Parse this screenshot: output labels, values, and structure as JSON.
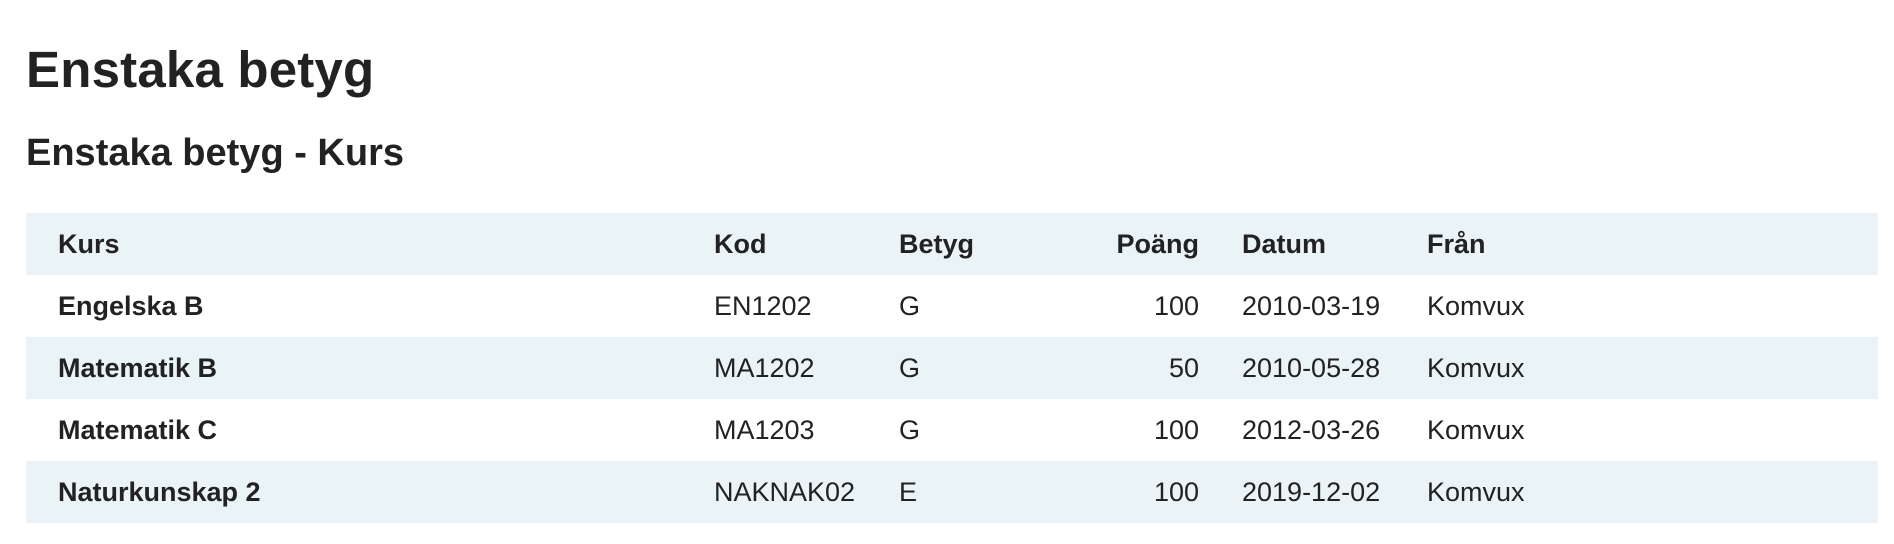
{
  "page": {
    "title": "Enstaka betyg",
    "subtitle": "Enstaka betyg - Kurs"
  },
  "table": {
    "columns": [
      "Kurs",
      "Kod",
      "Betyg",
      "Poäng",
      "Datum",
      "Från"
    ],
    "rows": [
      {
        "kurs": "Engelska B",
        "kod": "EN1202",
        "betyg": "G",
        "poang": "100",
        "datum": "2010-03-19",
        "fran": "Komvux"
      },
      {
        "kurs": "Matematik B",
        "kod": "MA1202",
        "betyg": "G",
        "poang": "50",
        "datum": "2010-05-28",
        "fran": "Komvux"
      },
      {
        "kurs": "Matematik C",
        "kod": "MA1203",
        "betyg": "G",
        "poang": "100",
        "datum": "2012-03-26",
        "fran": "Komvux"
      },
      {
        "kurs": "Naturkunskap 2",
        "kod": "NAKNAK02",
        "betyg": "E",
        "poang": "100",
        "datum": "2019-12-02",
        "fran": "Komvux"
      }
    ]
  },
  "colors": {
    "row_shade": "#eaf3f6",
    "text": "#222222"
  }
}
